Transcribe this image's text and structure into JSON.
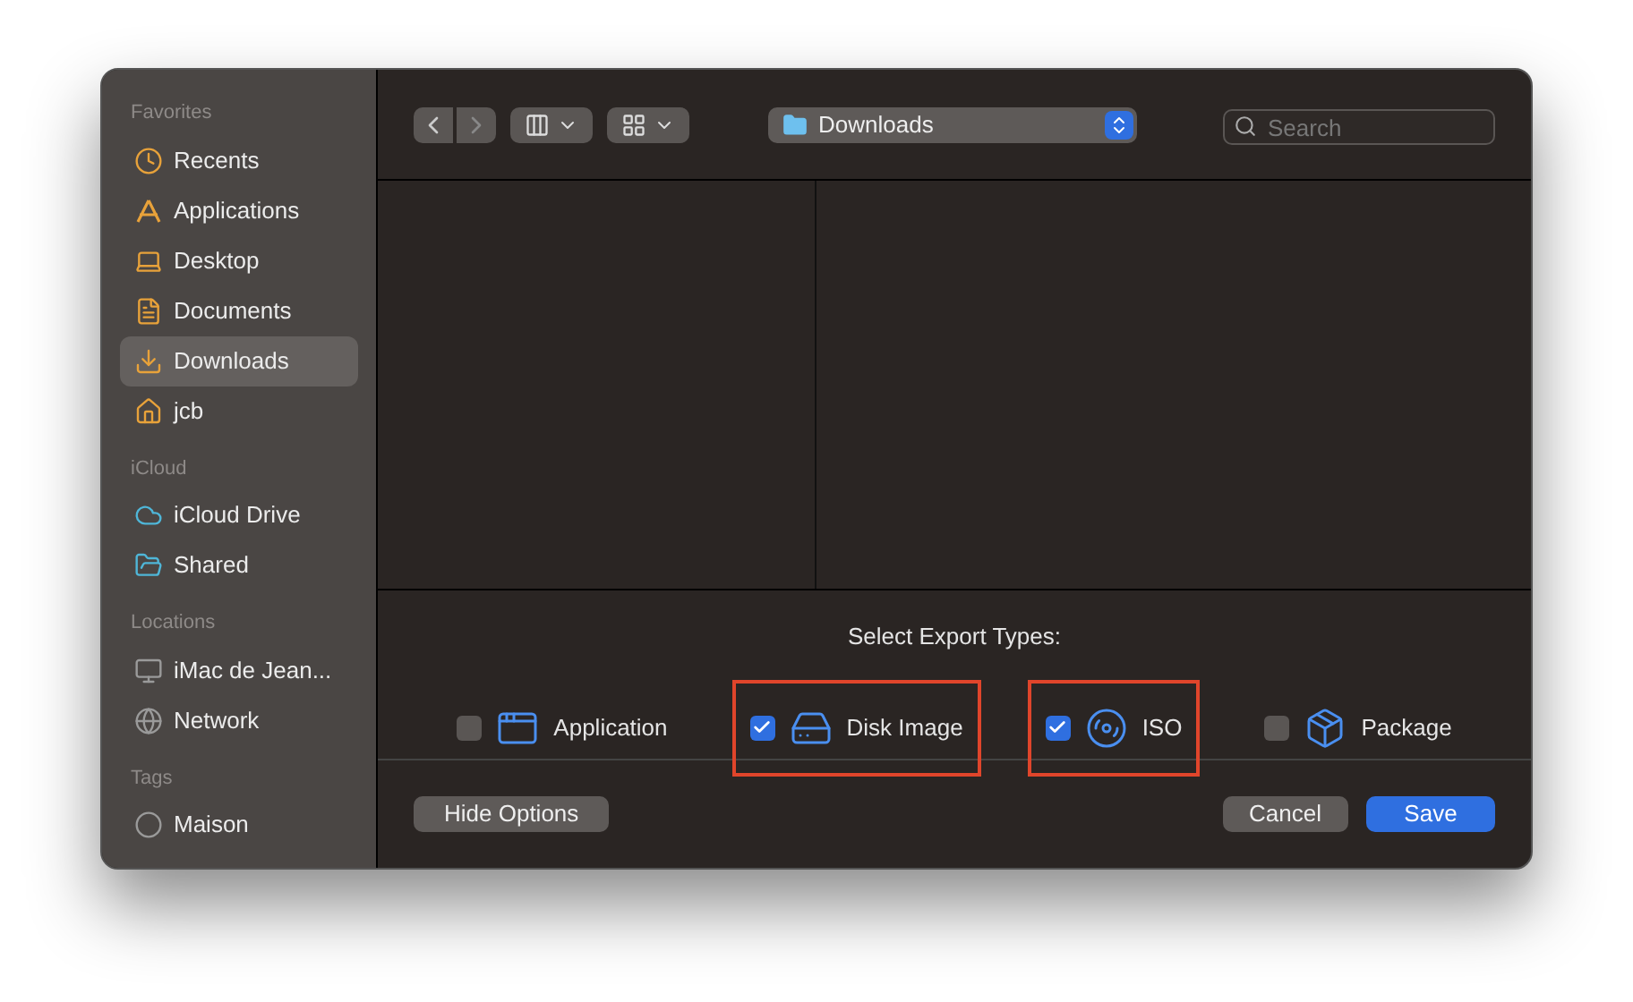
{
  "sidebar": {
    "sections": [
      {
        "title": "Favorites",
        "items": [
          {
            "label": "Recents",
            "kind": "clock",
            "selected": false
          },
          {
            "label": "Applications",
            "kind": "apps",
            "selected": false
          },
          {
            "label": "Desktop",
            "kind": "desktop",
            "selected": false
          },
          {
            "label": "Documents",
            "kind": "doc",
            "selected": false
          },
          {
            "label": "Downloads",
            "kind": "download",
            "selected": true
          },
          {
            "label": "jcb",
            "kind": "home",
            "selected": false
          }
        ]
      },
      {
        "title": "iCloud",
        "items": [
          {
            "label": "iCloud Drive",
            "kind": "cloud",
            "selected": false
          },
          {
            "label": "Shared",
            "kind": "shared",
            "selected": false
          }
        ]
      },
      {
        "title": "Locations",
        "items": [
          {
            "label": "iMac de Jean...",
            "kind": "computer",
            "selected": false
          },
          {
            "label": "Network",
            "kind": "globe",
            "selected": false
          }
        ]
      },
      {
        "title": "Tags",
        "items": [
          {
            "label": "Maison",
            "kind": "tag",
            "selected": false
          }
        ]
      }
    ]
  },
  "toolbar": {
    "location": "Downloads",
    "search": {
      "placeholder": "Search"
    }
  },
  "options": {
    "title": "Select Export Types:",
    "types": [
      {
        "label": "Application",
        "kind": "window",
        "checked": false,
        "highlighted": false
      },
      {
        "label": "Disk Image",
        "kind": "disk",
        "checked": true,
        "highlighted": true
      },
      {
        "label": "ISO",
        "kind": "cd",
        "checked": true,
        "highlighted": true
      },
      {
        "label": "Package",
        "kind": "box",
        "checked": false,
        "highlighted": false
      }
    ]
  },
  "buttons": {
    "hide_options": "Hide Options",
    "cancel": "Cancel",
    "save": "Save"
  }
}
